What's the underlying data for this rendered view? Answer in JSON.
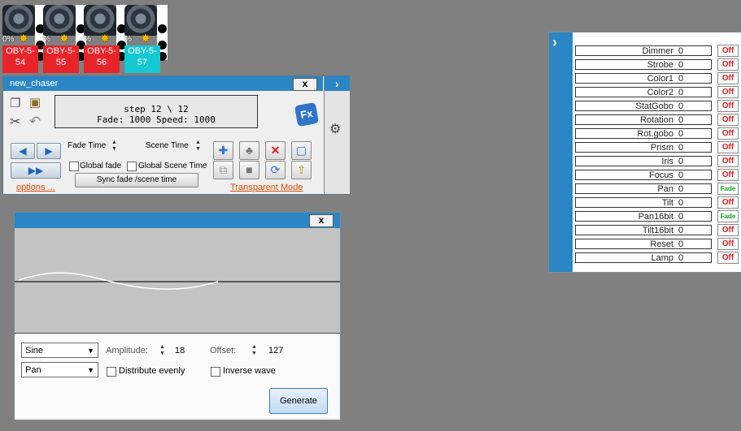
{
  "fixtures": [
    {
      "percent": "0%",
      "label_top": "OBY-5-",
      "label_bottom": "54",
      "color": "#e8242b"
    },
    {
      "percent": "%",
      "label_top": "OBY-5-",
      "label_bottom": "55",
      "color": "#e8242b"
    },
    {
      "percent": "%",
      "label_top": "OBY-5-",
      "label_bottom": "56",
      "color": "#e8242b"
    },
    {
      "percent": "%",
      "label_top": "OBY-5-",
      "label_bottom": "57",
      "color": "#16c8d3"
    }
  ],
  "chaser": {
    "title": "new_chaser",
    "close": "x",
    "step_line": "step 12 \\ 12",
    "fade_speed_line": "Fade: 1000  Speed: 1000",
    "fade_time_label": "Fade Time",
    "scene_time_label": "Scene Time",
    "global_fade_label": "Global fade",
    "global_scene_time_label": "Global Scene Time",
    "sync_button": "Sync fade /scene time",
    "options_link": "options ...",
    "transparent_link": "Transparent Mode",
    "fx_badge": "Fx"
  },
  "channels": {
    "collapse_icon": "chevron-right-icon",
    "rows": [
      {
        "name": "Dimmer",
        "value": "0",
        "button": "Off"
      },
      {
        "name": "Strobe",
        "value": "0",
        "button": "Off"
      },
      {
        "name": "Color1",
        "value": "0",
        "button": "Off"
      },
      {
        "name": "Color2",
        "value": "0",
        "button": "Off"
      },
      {
        "name": "StatGobo",
        "value": "0",
        "button": "Off"
      },
      {
        "name": "Rotation",
        "value": "0",
        "button": "Off"
      },
      {
        "name": "Rot.gobo",
        "value": "0",
        "button": "Off"
      },
      {
        "name": "Prism",
        "value": "0",
        "button": "Off"
      },
      {
        "name": "Iris",
        "value": "0",
        "button": "Off"
      },
      {
        "name": "Focus",
        "value": "0",
        "button": "Off"
      },
      {
        "name": "Pan",
        "value": "0",
        "button": "Fade"
      },
      {
        "name": "Tilt",
        "value": "0",
        "button": "Off"
      },
      {
        "name": "Pan16bit",
        "value": "0",
        "button": "Fade"
      },
      {
        "name": "Tilt16bit",
        "value": "0",
        "button": "Off"
      },
      {
        "name": "Reset",
        "value": "0",
        "button": "Off"
      },
      {
        "name": "Lamp",
        "value": "0",
        "button": "Off"
      }
    ]
  },
  "wave": {
    "close": "x",
    "waveform": "Sine",
    "channel": "Pan",
    "amplitude_label": "Amplitude:",
    "amplitude_value": "18",
    "offset_label": "Offset:",
    "offset_value": "127",
    "distribute_label": "Distribute evenly",
    "inverse_label": "Inverse wave",
    "generate_button": "Generate"
  }
}
